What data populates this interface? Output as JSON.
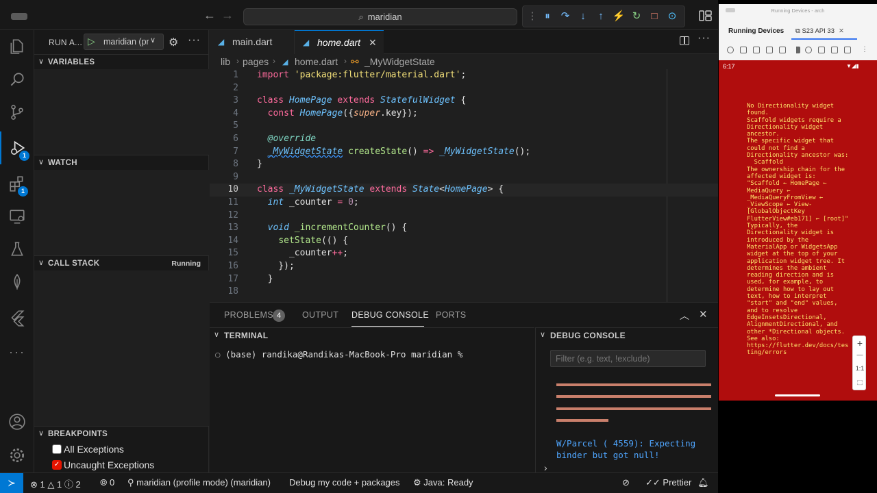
{
  "titlebar": {
    "search_text": "maridian"
  },
  "activity": {
    "run_debug_badge": "1",
    "extensions_badge": "1"
  },
  "sidebar": {
    "title": "RUN A...",
    "launch_config": "maridian (pr",
    "variables_title": "VARIABLES",
    "watch_title": "WATCH",
    "callstack_title": "CALL STACK",
    "callstack_status": "Running",
    "breakpoints_title": "BREAKPOINTS",
    "breakpoints": [
      {
        "label": "All Exceptions",
        "checked": false
      },
      {
        "label": "Uncaught Exceptions",
        "checked": true
      }
    ]
  },
  "editor": {
    "tabs": [
      {
        "label": "main.dart"
      },
      {
        "label": "home.dart"
      }
    ],
    "breadcrumb": [
      "lib",
      "pages",
      "home.dart",
      "_MyWidgetState"
    ],
    "line_numbers": [
      "1",
      "2",
      "3",
      "4",
      "5",
      "6",
      "7",
      "8",
      "9",
      "10",
      "11",
      "12",
      "13",
      "14",
      "15",
      "16",
      "17",
      "18"
    ],
    "current_line": "10"
  },
  "panel": {
    "tabs": {
      "problems": "PROBLEMS",
      "problems_count": "4",
      "output": "OUTPUT",
      "debug_console": "DEBUG CONSOLE",
      "ports": "PORTS"
    },
    "terminal_title": "TERMINAL",
    "terminal_prompt": "(base) randika@Randikas-MacBook-Pro maridian %",
    "debug_console_title": "DEBUG CONSOLE",
    "filter_placeholder": "Filter (e.g. text, !exclude)",
    "console_message": "W/Parcel  ( 4559): Expecting binder but got null!"
  },
  "statusbar": {
    "errors": "1",
    "warnings": "1",
    "infos": "2",
    "ports": "0",
    "debug_session": "maridian (profile mode) (maridian)",
    "debug_mode": "Debug my code + packages",
    "java_status": "Java: Ready",
    "prettier": "Prettier"
  },
  "devices": {
    "window_title": "Running Devices - arch",
    "tab_running": "Running Devices",
    "tab_device": "S23 API 33",
    "time": "6:17",
    "zoom_label": "1:1",
    "error_text": "No Directionality widget found.\nScaffold widgets require a Directionality widget ancestor.\nThe specific widget that could not find a Directionality ancestor was:\n  Scaffold\nThe ownership chain for the affected widget is:\n\"Scaffold ← HomePage ← MediaQuery ← _MediaQueryFromView ← _ViewScope ← View-[GlobalObjectKey FlutterView#eb171] ← [root]\"\nTypically, the Directionality widget is introduced by the MaterialApp or WidgetsApp widget at the top of your application widget tree. It determines the ambient reading direction and is used, for example, to determine how to lay out text, how to interpret \"start\" and \"end\" values, and to resolve EdgeInsetsDirectional, AlignmentDirectional, and other *Directional objects.\nSee also: https://flutter.dev/docs/testing/errors"
  },
  "colors": {
    "accent": "#0078d4",
    "error_screen": "#b00d0d",
    "error_text": "#ffe56b"
  }
}
